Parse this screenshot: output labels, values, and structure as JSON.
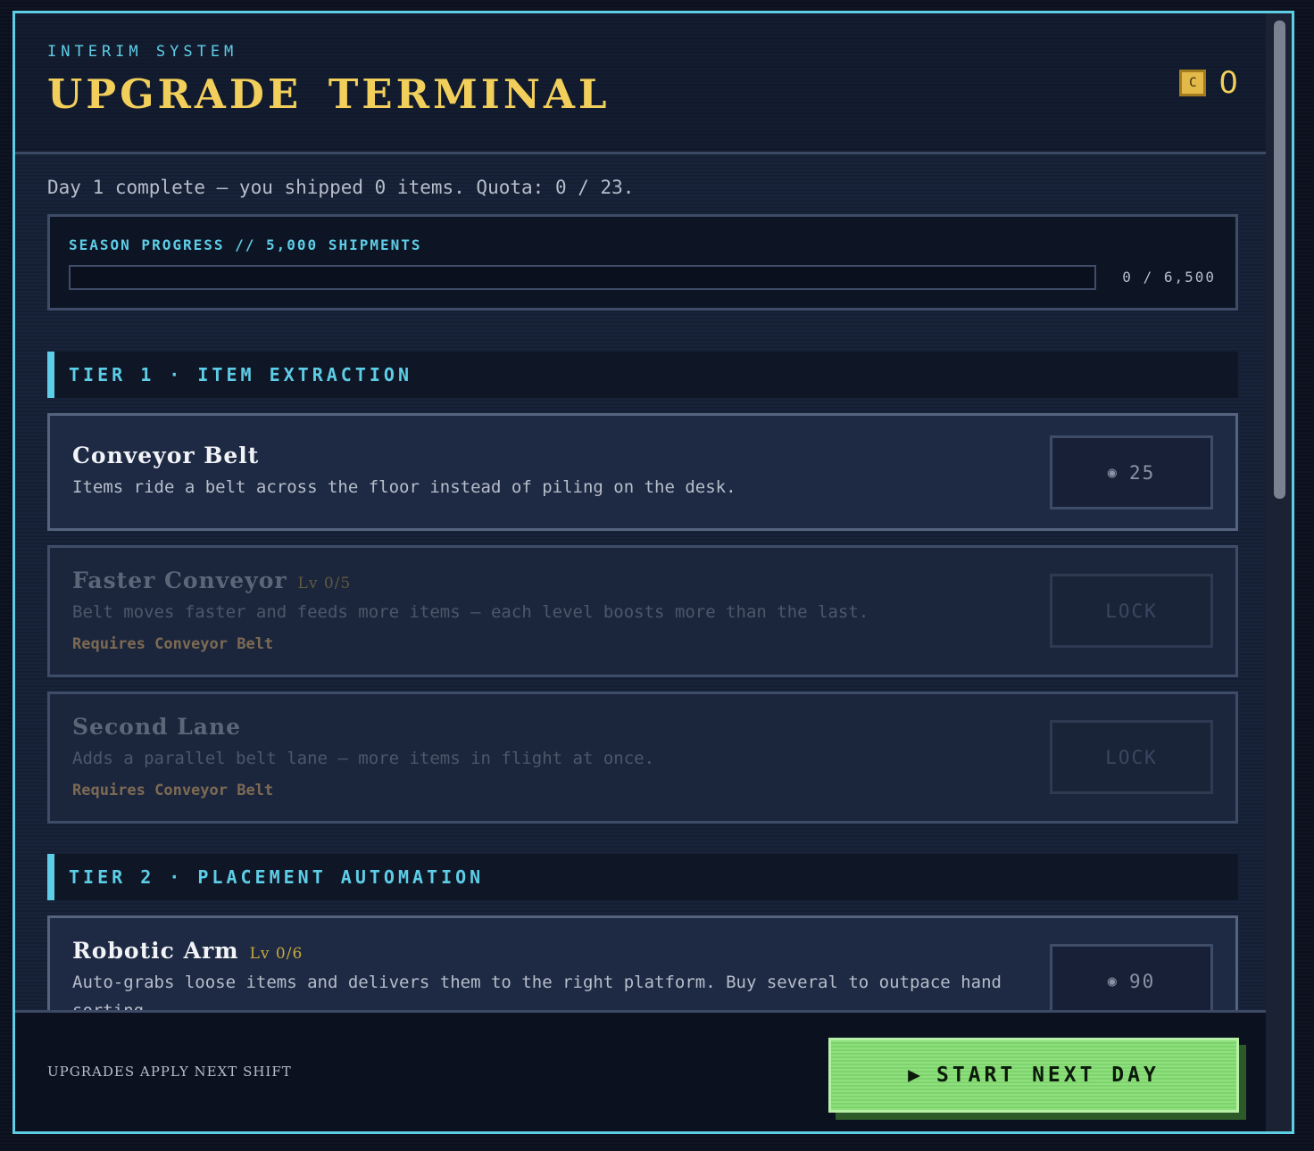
{
  "header": {
    "eyebrow": "INTERIM SYSTEM",
    "title": "UPGRADE TERMINAL",
    "coin_symbol": "C",
    "coins": "0"
  },
  "day_message": "Day 1 complete — you shipped 0 items. Quota: 0 / 23.",
  "season": {
    "label": "SEASON PROGRESS // 5,000 SHIPMENTS",
    "count": "0 / 6,500",
    "progress_fraction": 0
  },
  "tiers": [
    {
      "label": "TIER 1 · ITEM EXTRACTION",
      "upgrades": [
        {
          "name": "Conveyor Belt",
          "level": "",
          "description": "Items ride a belt across the floor instead of piling on the desk.",
          "requirement": "",
          "price_icon": "◉",
          "price": "25",
          "state": "available"
        },
        {
          "name": "Faster Conveyor",
          "level": "Lv 0/5",
          "description": "Belt moves faster and feeds more items — each level boosts more than the last.",
          "requirement": "Requires Conveyor Belt",
          "price_icon": "",
          "price": "LOCK",
          "state": "locked"
        },
        {
          "name": "Second Lane",
          "level": "",
          "description": "Adds a parallel belt lane — more items in flight at once.",
          "requirement": "Requires Conveyor Belt",
          "price_icon": "",
          "price": "LOCK",
          "state": "locked"
        }
      ]
    },
    {
      "label": "TIER 2 · PLACEMENT AUTOMATION",
      "upgrades": [
        {
          "name": "Robotic Arm",
          "level": "Lv 0/6",
          "description": "Auto-grabs loose items and delivers them to the right platform. Buy several to outpace hand sorting.",
          "requirement": "",
          "price_icon": "◉",
          "price": "90",
          "state": "available"
        }
      ]
    }
  ],
  "footer": {
    "note": "UPGRADES APPLY NEXT SHIFT",
    "start_icon": "▶",
    "start_label": "START NEXT DAY"
  },
  "colors": {
    "accent": "#5ecde6",
    "title": "#f2cf5b",
    "start_button": "#8de07c"
  }
}
